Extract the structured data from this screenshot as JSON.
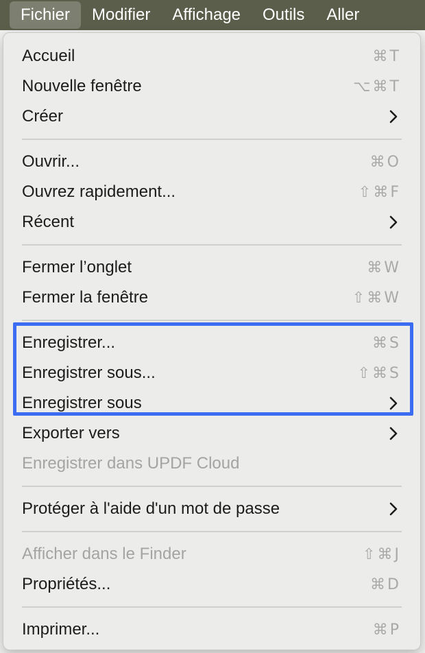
{
  "menubar": {
    "items": [
      "Fichier",
      "Modifier",
      "Affichage",
      "Outils",
      "Aller"
    ]
  },
  "menu": {
    "items": [
      {
        "label": "Accueil",
        "shortcut": "⌘T"
      },
      {
        "label": "Nouvelle fenêtre",
        "shortcut": "⌥⌘T"
      },
      {
        "label": "Créer",
        "submenu": true
      },
      {
        "label": "Ouvrir...",
        "shortcut": "⌘O"
      },
      {
        "label": "Ouvrez rapidement...",
        "shortcut": "⇧⌘F"
      },
      {
        "label": "Récent",
        "submenu": true
      },
      {
        "label": "Fermer l’onglet",
        "shortcut": "⌘W"
      },
      {
        "label": "Fermer la fenêtre",
        "shortcut": "⇧⌘W"
      },
      {
        "label": "Enregistrer...",
        "shortcut": "⌘S"
      },
      {
        "label": "Enregistrer sous...",
        "shortcut": "⇧⌘S"
      },
      {
        "label": "Enregistrer sous",
        "submenu": true
      },
      {
        "label": "Exporter vers",
        "submenu": true
      },
      {
        "label": "Enregistrer dans UPDF Cloud",
        "disabled": true
      },
      {
        "label": "Protéger à l'aide d'un mot de passe",
        "submenu": true
      },
      {
        "label": "Afficher dans le Finder",
        "shortcut": "⇧⌘J",
        "disabled": true
      },
      {
        "label": "Propriétés...",
        "shortcut": "⌘D"
      },
      {
        "label": "Imprimer...",
        "shortcut": "⌘P"
      }
    ]
  },
  "colors": {
    "menubar_bg": "#5b5e4a",
    "menu_bg": "#ececea",
    "highlight_border": "#3b6cf2",
    "disabled_text": "#a4a4a2"
  },
  "icons": {
    "submenu": "chevron-right-icon"
  }
}
